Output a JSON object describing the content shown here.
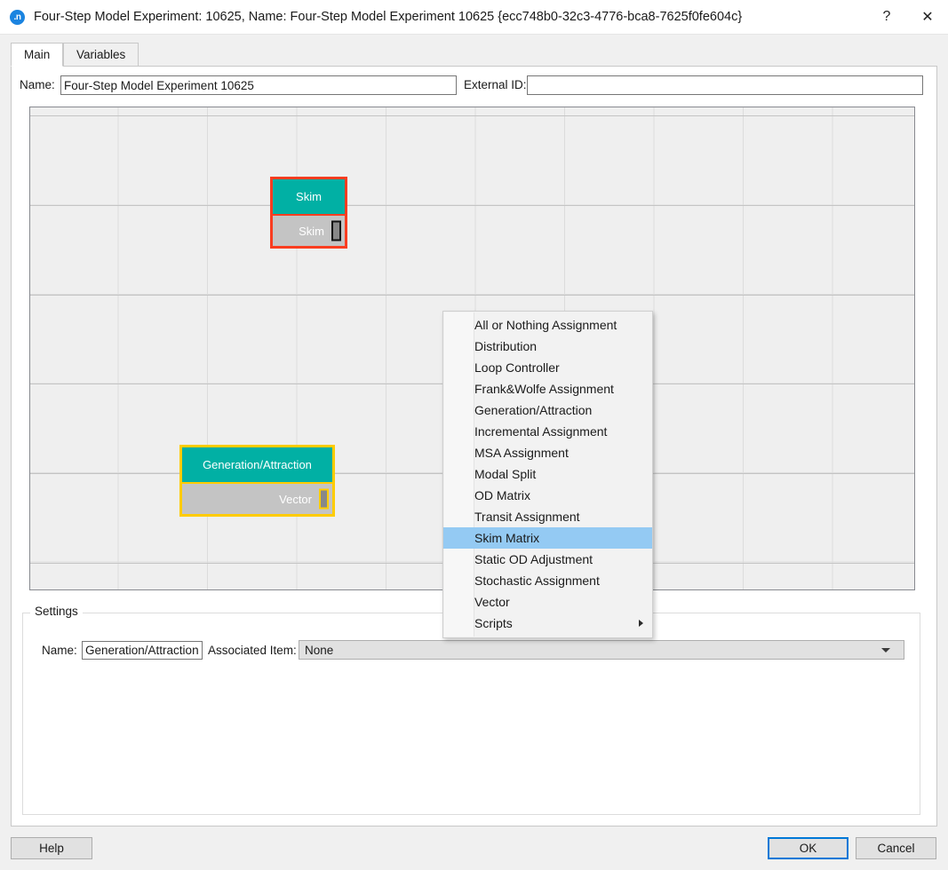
{
  "window": {
    "icon": "app-logo-icon",
    "title": "Four-Step Model Experiment: 10625, Name: Four-Step Model Experiment 10625  {ecc748b0-32c3-4776-bca8-7625f0fe604c}",
    "help_glyph": "?",
    "close_glyph": "✕"
  },
  "tabs": [
    {
      "label": "Main",
      "active": true
    },
    {
      "label": "Variables",
      "active": false
    }
  ],
  "header_form": {
    "name_label": "Name:",
    "name_value": "Four-Step Model Experiment 10625",
    "external_id_label": "External ID:",
    "external_id_value": ""
  },
  "canvas": {
    "nodes": [
      {
        "id": "skim",
        "title": "Skim",
        "body_label": "Skim",
        "selection_color": "#f93d20",
        "header_color": "#01b0a4",
        "body_color": "#c4c4c4"
      },
      {
        "id": "generation-attraction",
        "title": "Generation/Attraction",
        "body_label": "Vector",
        "selection_color": "#ffcc00",
        "header_color": "#01b0a4",
        "body_color": "#c4c4c4"
      }
    ]
  },
  "context_menu": {
    "highlight_color": "#94caf3",
    "items": [
      {
        "label": "All or Nothing Assignment",
        "selected": false,
        "submenu": false
      },
      {
        "label": "Distribution",
        "selected": false,
        "submenu": false
      },
      {
        "label": "Loop Controller",
        "selected": false,
        "submenu": false
      },
      {
        "label": "Frank&Wolfe Assignment",
        "selected": false,
        "submenu": false
      },
      {
        "label": "Generation/Attraction",
        "selected": false,
        "submenu": false
      },
      {
        "label": "Incremental Assignment",
        "selected": false,
        "submenu": false
      },
      {
        "label": "MSA Assignment",
        "selected": false,
        "submenu": false
      },
      {
        "label": "Modal Split",
        "selected": false,
        "submenu": false
      },
      {
        "label": "OD Matrix",
        "selected": false,
        "submenu": false
      },
      {
        "label": "Transit Assignment",
        "selected": false,
        "submenu": false
      },
      {
        "label": "Skim Matrix",
        "selected": true,
        "submenu": false
      },
      {
        "label": "Static OD Adjustment",
        "selected": false,
        "submenu": false
      },
      {
        "label": "Stochastic Assignment",
        "selected": false,
        "submenu": false
      },
      {
        "label": "Vector",
        "selected": false,
        "submenu": false
      },
      {
        "label": "Scripts",
        "selected": false,
        "submenu": true
      }
    ]
  },
  "settings": {
    "legend": "Settings",
    "name_label": "Name:",
    "name_value": "Generation/Attraction",
    "associated_item_label": "Associated Item:",
    "associated_item_value": "None"
  },
  "footer": {
    "help_label": "Help",
    "ok_label": "OK",
    "cancel_label": "Cancel"
  }
}
